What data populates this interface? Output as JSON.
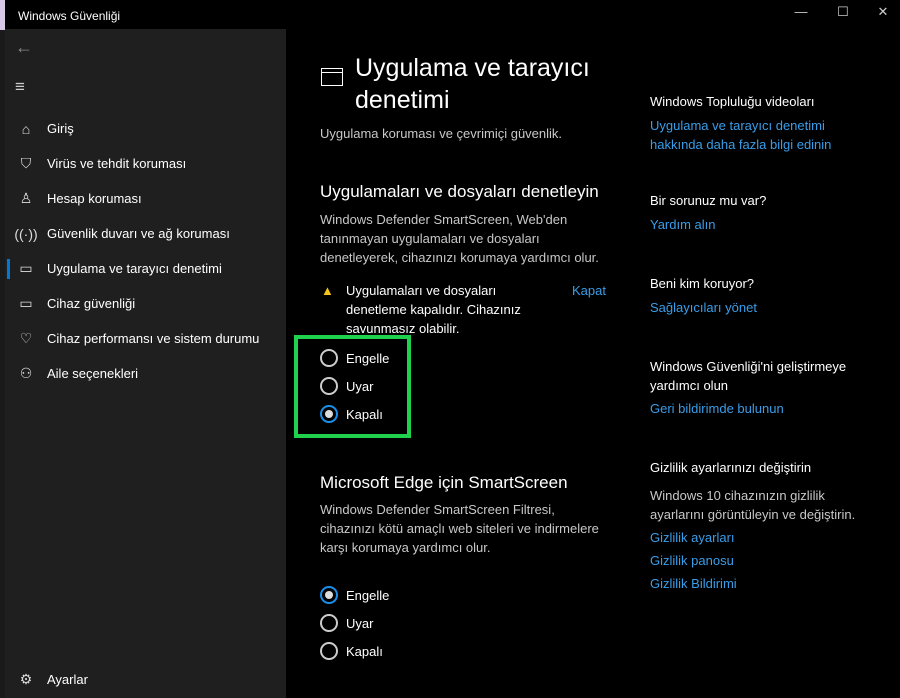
{
  "window": {
    "title": "Windows Güvenliği",
    "minimize": "—",
    "maximize": "☐",
    "close": "✕"
  },
  "sidebar": {
    "back": "←",
    "menu": "≡",
    "items": [
      {
        "label": "Giriş",
        "icon": "home-icon",
        "glyph": "⌂"
      },
      {
        "label": "Virüs ve tehdit koruması",
        "icon": "shield-icon",
        "glyph": "⛉"
      },
      {
        "label": "Hesap koruması",
        "icon": "person-icon",
        "glyph": "♙"
      },
      {
        "label": "Güvenlik duvarı ve ağ koruması",
        "icon": "wifi-icon",
        "glyph": "((·))"
      },
      {
        "label": "Uygulama ve tarayıcı denetimi",
        "icon": "browser-icon",
        "glyph": "▭"
      },
      {
        "label": "Cihaz güvenliği",
        "icon": "laptop-icon",
        "glyph": "▭"
      },
      {
        "label": "Cihaz performansı ve sistem durumu",
        "icon": "heart-icon",
        "glyph": "♡"
      },
      {
        "label": "Aile seçenekleri",
        "icon": "family-icon",
        "glyph": "⚇"
      }
    ],
    "settings": {
      "label": "Ayarlar",
      "glyph": "⚙"
    }
  },
  "main": {
    "title": "Uygulama ve tarayıcı denetimi",
    "subtitle": "Uygulama koruması ve çevrimiçi güvenlik.",
    "section1": {
      "heading": "Uygulamaları ve dosyaları denetleyin",
      "desc": "Windows Defender SmartScreen, Web'den tanınmayan uygulamaları ve dosyaları denetleyerek, cihazınızı korumaya yardımcı olur.",
      "warning": "Uygulamaları ve dosyaları denetleme kapalıdır. Cihazınız savunmasız olabilir.",
      "dismiss": "Kapat",
      "options": [
        "Engelle",
        "Uyar",
        "Kapalı"
      ],
      "selected": "Kapalı"
    },
    "section2": {
      "heading": "Microsoft Edge için SmartScreen",
      "desc": "Windows Defender SmartScreen Filtresi, cihazınızı kötü amaçlı web siteleri ve indirmelere karşı korumaya yardımcı olur.",
      "options": [
        "Engelle",
        "Uyar",
        "Kapalı"
      ],
      "selected": "Engelle"
    }
  },
  "right": {
    "videos": {
      "heading": "Windows Topluluğu videoları",
      "link": "Uygulama ve tarayıcı denetimi hakkında daha fazla bilgi edinin"
    },
    "help": {
      "heading": "Bir sorunuz mu var?",
      "link": "Yardım alın"
    },
    "who": {
      "heading": "Beni kim koruyor?",
      "link": "Sağlayıcıları yönet"
    },
    "improve": {
      "heading": "Windows Güvenliği'ni geliştirmeye yardımcı olun",
      "link": "Geri bildirimde bulunun"
    },
    "privacy": {
      "heading": "Gizlilik ayarlarınızı değiştirin",
      "desc": "Windows 10 cihazınızın gizlilik ayarlarını görüntüleyin ve değiştirin.",
      "links": [
        "Gizlilik ayarları",
        "Gizlilik panosu",
        "Gizlilik Bildirimi"
      ]
    }
  }
}
